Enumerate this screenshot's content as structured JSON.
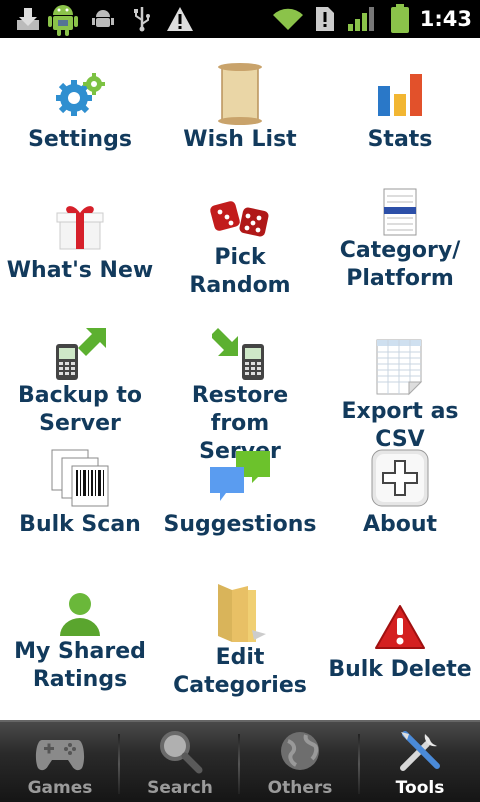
{
  "status_bar": {
    "time": "1:43",
    "icons": [
      "download-icon",
      "android-icon",
      "usb-icon",
      "warning-icon",
      "wifi-icon",
      "sim-icon",
      "signal-icon",
      "battery-icon"
    ]
  },
  "grid": {
    "items": [
      {
        "label": "Settings",
        "icon": "gears-icon"
      },
      {
        "label": "Wish List",
        "icon": "scroll-icon"
      },
      {
        "label": "Stats",
        "icon": "bar-chart-icon"
      },
      {
        "label": "What's New",
        "icon": "gift-icon"
      },
      {
        "label": "Pick Random",
        "icon": "dice-icon"
      },
      {
        "label": "Category/\nPlatform",
        "icon": "list-icon"
      },
      {
        "label": "Backup to\nServer",
        "icon": "phone-upload-icon"
      },
      {
        "label": "Restore from\nServer",
        "icon": "phone-download-icon"
      },
      {
        "label": "Export as CSV",
        "icon": "spreadsheet-icon"
      },
      {
        "label": "Bulk Scan",
        "icon": "barcode-icon"
      },
      {
        "label": "Suggestions",
        "icon": "chat-bubbles-icon"
      },
      {
        "label": "About",
        "icon": "plus-button-icon"
      },
      {
        "label": "My Shared\nRatings",
        "icon": "user-icon"
      },
      {
        "label": "Edit\nCategories",
        "icon": "folder-icon"
      },
      {
        "label": "Bulk Delete",
        "icon": "warning-triangle-icon"
      }
    ]
  },
  "tabs": [
    {
      "label": "Games",
      "icon": "gamepad-icon",
      "active": false
    },
    {
      "label": "Search",
      "icon": "magnifier-icon",
      "active": false
    },
    {
      "label": "Others",
      "icon": "globe-icon",
      "active": false
    },
    {
      "label": "Tools",
      "icon": "tools-icon",
      "active": true
    }
  ],
  "colors": {
    "label": "#123a5c",
    "tab_active": "#ffffff",
    "tab_inactive": "#9a9a9a"
  }
}
